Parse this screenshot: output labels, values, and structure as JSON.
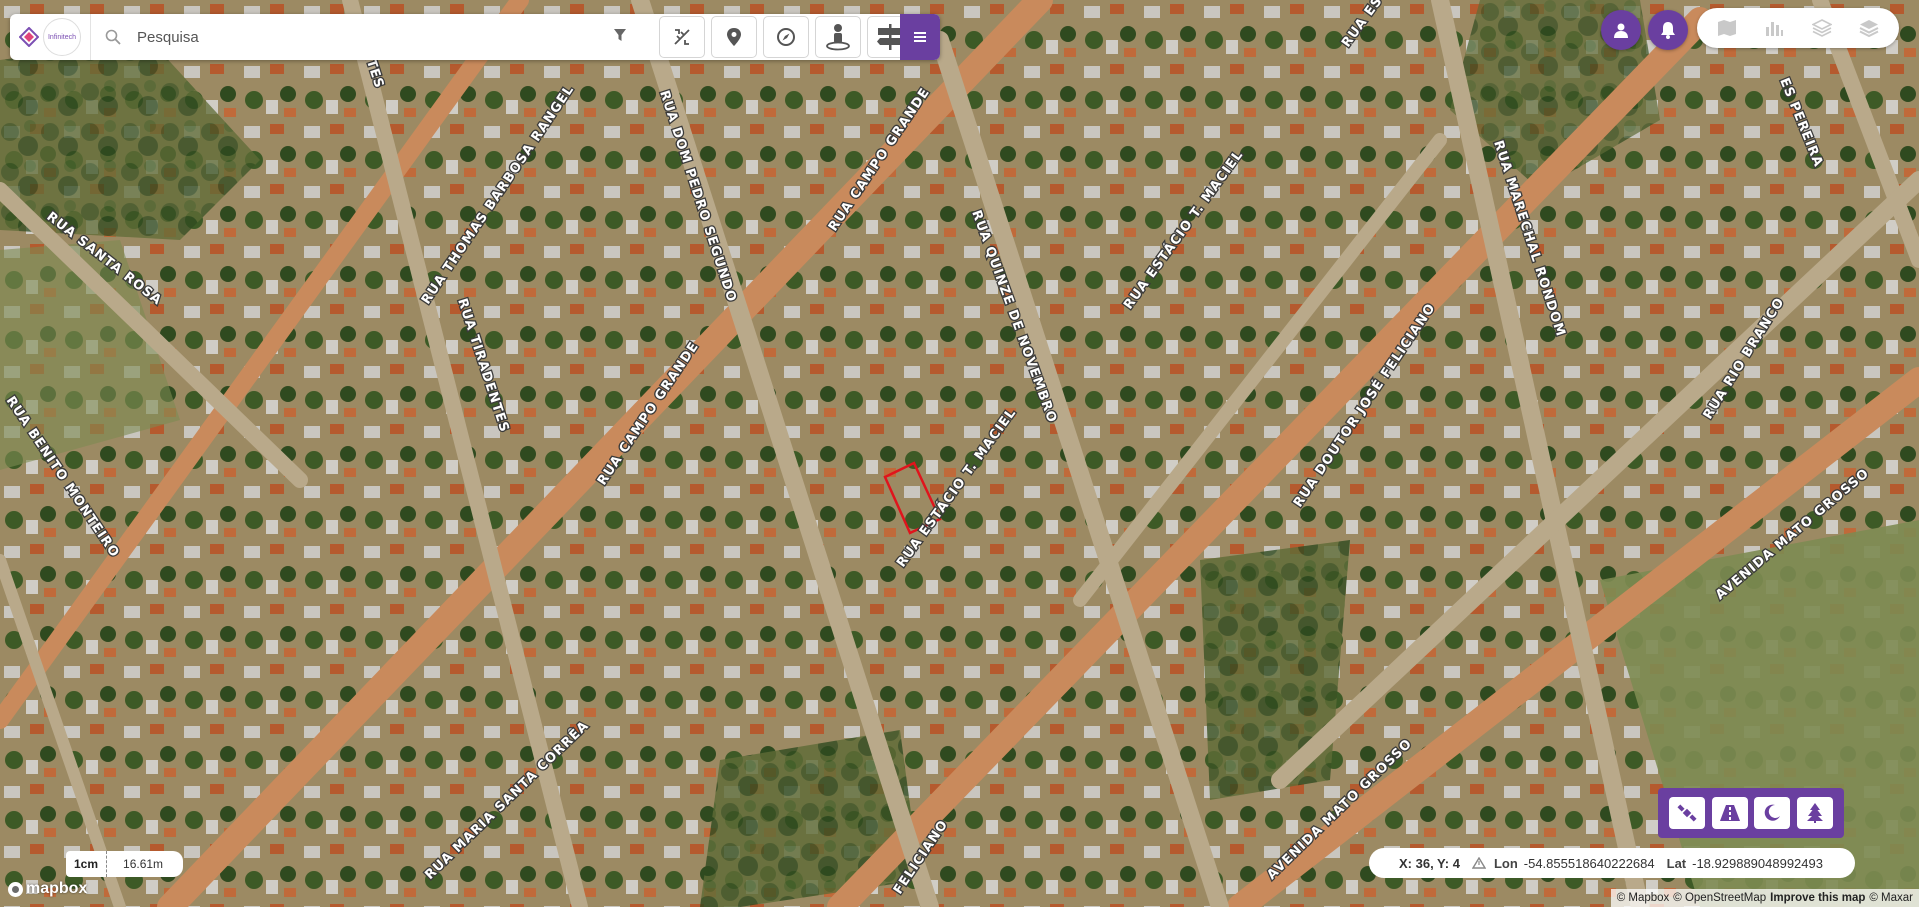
{
  "search": {
    "placeholder": "Pesquisa"
  },
  "brand": {
    "logo_text": "Infinitech"
  },
  "toolbar": {
    "tools": [
      {
        "icon": "measure-icon"
      },
      {
        "icon": "pin-icon"
      },
      {
        "icon": "compass-icon"
      },
      {
        "icon": "street-view-icon"
      },
      {
        "icon": "signpost-icon"
      }
    ],
    "menu_icon": "hamburger-icon"
  },
  "top_right": {
    "user_icon": "user-icon",
    "notifications_icon": "bell-icon",
    "layers": [
      "map-icon",
      "chart-icon",
      "layers-outline-icon",
      "layers-filled-icon"
    ]
  },
  "streets": [
    "RUA SANTA ROSA",
    "RUA BENITO MONTEIRO",
    "RUA THOMAS BARBOSA RANGEL",
    "RUA TIRADENTES",
    "RUA DOM PEDRO SEGUNDO",
    "RUA CAMPO GRANDE",
    "RUA CAMPO GRANDE",
    "RUA QUINZE DE NOVEMBRO",
    "RUA ESTÁCIO T. MACIEL",
    "RUA ESTÁCIO T. MACIEL",
    "RUA DOUTOR JOSÉ FELICIANO",
    "RUA MARECHAL RONDOM",
    "RUA RIO BRANCO",
    "AVENIDA MATO GROSSO",
    "AVENIDA MATO GROSSO",
    "RUA MARIA SANTA CORRÊA",
    "ENTES",
    "ES PEREIRA",
    "FELICIANO",
    "RUA ESTÁ"
  ],
  "bottom_tools": [
    "satellite-icon",
    "road-icon",
    "moon-icon",
    "tree-icon"
  ],
  "coords": {
    "xy_label": "X: 36, Y: 4",
    "lon_label": "Lon",
    "lon_value": "-54.855518640222684",
    "lat_label": "Lat",
    "lat_value": "-18.929889048992493"
  },
  "scale": {
    "unit": "1cm",
    "value": "16.61m"
  },
  "mapbox": {
    "logo_text": "mapbox"
  },
  "attribution": {
    "mapbox": "© Mapbox",
    "osm": "© OpenStreetMap",
    "improve": "Improve this map",
    "maxar": "© Maxar"
  },
  "colors": {
    "accent": "#6a3fa0",
    "selection": "#e0141c"
  }
}
